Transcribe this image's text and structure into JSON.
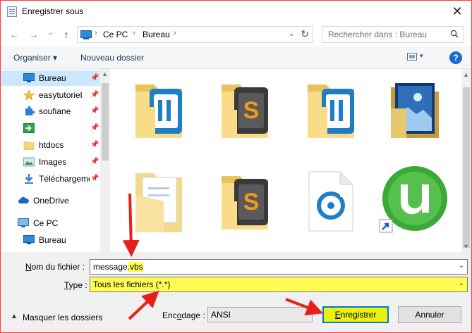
{
  "window": {
    "title": "Enregistrer sous",
    "close_label": "✕"
  },
  "nav": {
    "back": "←",
    "forward": "→",
    "recent": "⌄",
    "up": "↑",
    "breadcrumb": [
      "Ce PC",
      "Bureau"
    ],
    "separator": "›",
    "search_placeholder": "Rechercher dans : Bureau"
  },
  "toolbar": {
    "organize_label": "Organiser ▾",
    "new_folder_label": "Nouveau dossier",
    "help_label": "?"
  },
  "sidebar": {
    "items": [
      {
        "label": "Bureau",
        "icon": "desktop-icon",
        "pinned": true,
        "selected": true
      },
      {
        "label": "easytutoriel",
        "icon": "star-icon",
        "pinned": true
      },
      {
        "label": "soufiane",
        "icon": "puzzle-icon",
        "pinned": true
      },
      {
        "label": "",
        "icon": "green-arrow-icon",
        "pinned": true
      },
      {
        "label": "htdocs",
        "icon": "folder-icon",
        "pinned": true
      },
      {
        "label": "Images",
        "icon": "images-icon",
        "pinned": true
      },
      {
        "label": "Téléchargements",
        "icon": "download-icon",
        "pinned": true
      },
      {
        "label": "OneDrive",
        "icon": "cloud-icon",
        "pinned": false
      },
      {
        "label": "Ce PC",
        "icon": "computer-icon",
        "pinned": false
      },
      {
        "label": "Bureau",
        "icon": "desktop-icon",
        "pinned": false
      }
    ]
  },
  "files": [
    {
      "icon": "folder-app-blue-icon"
    },
    {
      "icon": "folder-sublime-icon"
    },
    {
      "icon": "folder-sublime-icon"
    },
    {
      "icon": "wallpaper-folder-icon"
    },
    {
      "icon": "folder-documents-icon"
    },
    {
      "icon": "folder-sublime-icon"
    },
    {
      "icon": "media-file-icon"
    },
    {
      "icon": "utorrent-shortcut-icon"
    }
  ],
  "form": {
    "filename_label_u": "N",
    "filename_label_rest": "om du fichier :",
    "filename_value": "message.vbs",
    "filename_plain": "message",
    "filename_ext": ".vbs",
    "type_label_u": "T",
    "type_label_rest": "ype :",
    "type_value": "Tous les fichiers  (*.*)",
    "hide_folders_label": "Masquer les dossiers",
    "encoding_label_rest": "Enc",
    "encoding_label_u": "o",
    "encoding_label_end": "dage :",
    "encoding_value": "ANSI",
    "save_u": "E",
    "save_rest": "nregistrer",
    "cancel_label": "Annuler"
  },
  "colors": {
    "highlight": "#fffd54",
    "annotation_arrow": "#e8201c",
    "accent": "#0078d7"
  }
}
